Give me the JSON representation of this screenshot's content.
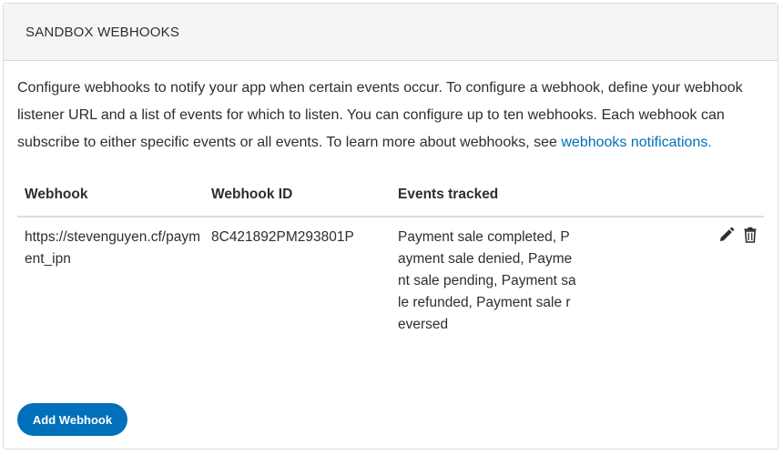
{
  "panel": {
    "title": "SANDBOX WEBHOOKS"
  },
  "description": {
    "text": "Configure webhooks to notify your app when certain events occur. To configure a webhook, define your webhook listener URL and a list of events for which to listen. You can configure up to ten webhooks. Each webhook can subscribe to either specific events or all events. To learn more about webhooks, see ",
    "link_text": "webhooks notifications."
  },
  "table": {
    "headers": {
      "webhook": "Webhook",
      "webhook_id": "Webhook ID",
      "events": "Events tracked"
    },
    "rows": [
      {
        "url": "https://stevenguyen.cf/payment_ipn",
        "id": "8C421892PM293801P",
        "events": "Payment sale completed, Payment sale denied, Payment sale pending, Payment sale refunded, Payment sale reversed",
        "edit_icon": "pencil-icon",
        "delete_icon": "trash-icon"
      }
    ]
  },
  "actions": {
    "add_label": "Add Webhook"
  },
  "colors": {
    "accent": "#0070ba",
    "header_bg": "#f5f5f5",
    "border": "#dcdcdc",
    "text": "#2c2e2f"
  }
}
